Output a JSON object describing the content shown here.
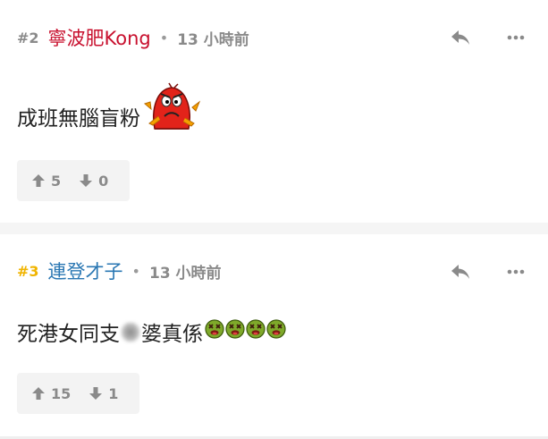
{
  "posts": [
    {
      "number": "#2",
      "username": "寧波肥Kong",
      "separator": "•",
      "time": "13 小時前",
      "text": "成班無腦盲粉",
      "emoji": "angry-red-monster-icon",
      "upvotes": "5",
      "downvotes": "0",
      "number_color": "#8a8a8a",
      "user_color": "#c8102e"
    },
    {
      "number": "#3",
      "username": "連登才子",
      "separator": "•",
      "time": "13 小時前",
      "text_before": "死港女同支",
      "text_after": "婆真係",
      "emoji": "sick-face-icon",
      "emoji_count": 4,
      "upvotes": "15",
      "downvotes": "1",
      "number_color": "#f0b400",
      "user_color": "#2a77b3"
    }
  ],
  "colors": {
    "page_background": "#f5f5f5",
    "card_background": "#ffffff",
    "vote_background": "#f3f3f3",
    "icon_gray": "#8a8a8a"
  }
}
